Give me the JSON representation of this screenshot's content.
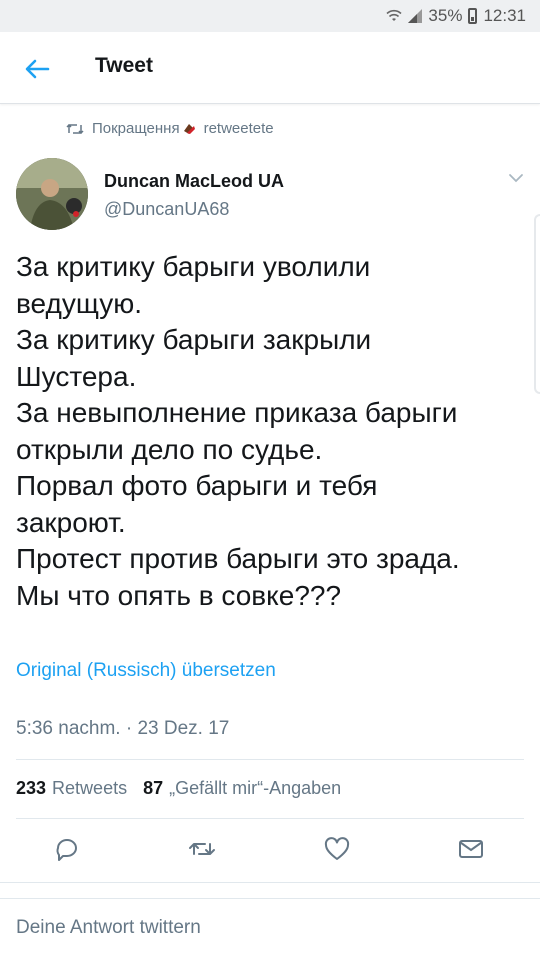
{
  "status_bar": {
    "battery": "35%",
    "time": "12:31"
  },
  "app_bar": {
    "title": "Tweet"
  },
  "social_context": {
    "text": "Покращення",
    "suffix": "retweetete"
  },
  "author": {
    "name": "Duncan MacLeod UA",
    "handle": "@DuncanUA68"
  },
  "tweet": {
    "lines": [
      "За критику барыги уволили",
      "ведущую.",
      "За критику барыги закрыли",
      "Шустера.",
      "За невыполнение приказа барыги",
      "открыли дело по судье.",
      "Порвал фото барыги и тебя",
      "закроют.",
      "Протест против барыги это зрада.",
      "Мы что опять в совке???"
    ],
    "translate_label": "Original (Russisch) übersetzen",
    "timestamp": "5:36 nachm. · 23 Dez. 17"
  },
  "stats": {
    "retweets_count": "233",
    "retweets_label": "Retweets",
    "likes_count": "87",
    "likes_label": "„Gefällt mir“-Angaben"
  },
  "actions": [
    "reply-icon",
    "retweet-icon",
    "like-icon",
    "message-icon"
  ],
  "reply": {
    "placeholder": "Deine Antwort twittern"
  },
  "colors": {
    "accent": "#1da1f2",
    "secondary_text": "#657786",
    "primary_text": "#14171a"
  }
}
